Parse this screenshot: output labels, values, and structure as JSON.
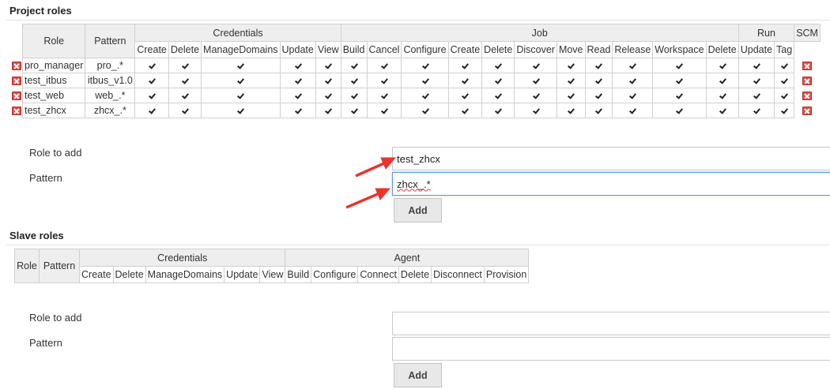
{
  "project": {
    "title": "Project roles",
    "headers": {
      "role": "Role",
      "pattern": "Pattern",
      "groups": [
        {
          "label": "Credentials",
          "span": 5
        },
        {
          "label": "Job",
          "span": 11
        },
        {
          "label": "Run",
          "span": 2
        },
        {
          "label": "SCM",
          "span": 1
        }
      ],
      "permissions": [
        "Create",
        "Delete",
        "ManageDomains",
        "Update",
        "View",
        "Build",
        "Cancel",
        "Configure",
        "Create",
        "Delete",
        "Discover",
        "Move",
        "Read",
        "Release",
        "Workspace",
        "Delete",
        "Update",
        "Tag"
      ]
    },
    "rows": [
      {
        "role": "pro_manager",
        "pattern": "pro_.*"
      },
      {
        "role": "test_itbus",
        "pattern": "itbus_v1.0"
      },
      {
        "role": "test_web",
        "pattern": "web_.*"
      },
      {
        "role": "test_zhcx",
        "pattern": "zhcx_.*"
      }
    ],
    "role_to_add_label": "Role to add",
    "pattern_label": "Pattern",
    "role_to_add_value": "test_zhcx",
    "pattern_value": "zhcx_.*",
    "add_label": "Add"
  },
  "slave": {
    "title": "Slave roles",
    "headers": {
      "role": "Role",
      "pattern": "Pattern",
      "groups": [
        {
          "label": "Credentials",
          "span": 5
        },
        {
          "label": "Agent",
          "span": 6
        }
      ],
      "permissions": [
        "Create",
        "Delete",
        "ManageDomains",
        "Update",
        "View",
        "Build",
        "Configure",
        "Connect",
        "Delete",
        "Disconnect",
        "Provision"
      ]
    },
    "role_to_add_label": "Role to add",
    "pattern_label": "Pattern",
    "role_to_add_value": "",
    "pattern_value": "",
    "add_label": "Add"
  },
  "colors": {
    "arrow": "#e8352e",
    "header_bg": "#eeeeee",
    "delete_icon": "#d9534f"
  },
  "icons": {
    "delete": "delete-x-icon",
    "check": "checkbox-checked-icon",
    "arrow": "annotation-arrow-icon"
  }
}
